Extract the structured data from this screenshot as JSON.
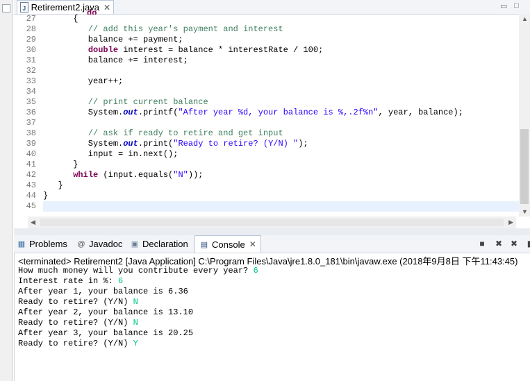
{
  "editor": {
    "tab_label": "Retirement2.java",
    "partial_line_text": "do",
    "lines": [
      {
        "n": "27",
        "tokens": [
          {
            "t": "      {",
            "c": ""
          }
        ]
      },
      {
        "n": "28",
        "tokens": [
          {
            "t": "         // add this year's payment and interest",
            "c": "cm"
          }
        ]
      },
      {
        "n": "29",
        "tokens": [
          {
            "t": "         balance += payment;",
            "c": ""
          }
        ]
      },
      {
        "n": "30",
        "tokens": [
          {
            "t": "         ",
            "c": ""
          },
          {
            "t": "double",
            "c": "kw"
          },
          {
            "t": " interest = balance * interestRate / 100;",
            "c": ""
          }
        ]
      },
      {
        "n": "31",
        "tokens": [
          {
            "t": "         balance += interest;",
            "c": ""
          }
        ]
      },
      {
        "n": "32",
        "tokens": []
      },
      {
        "n": "33",
        "tokens": [
          {
            "t": "         year++;",
            "c": ""
          }
        ]
      },
      {
        "n": "34",
        "tokens": []
      },
      {
        "n": "35",
        "tokens": [
          {
            "t": "         // print current balance",
            "c": "cm"
          }
        ]
      },
      {
        "n": "36",
        "tokens": [
          {
            "t": "         System.",
            "c": ""
          },
          {
            "t": "out",
            "c": "fi"
          },
          {
            "t": ".printf(",
            "c": ""
          },
          {
            "t": "\"After year %d, your balance is %,.2f%n\"",
            "c": "st"
          },
          {
            "t": ", year, balance);",
            "c": ""
          }
        ]
      },
      {
        "n": "37",
        "tokens": []
      },
      {
        "n": "38",
        "tokens": [
          {
            "t": "         // ask if ready to retire and get input",
            "c": "cm"
          }
        ]
      },
      {
        "n": "39",
        "tokens": [
          {
            "t": "         System.",
            "c": ""
          },
          {
            "t": "out",
            "c": "fi"
          },
          {
            "t": ".print(",
            "c": ""
          },
          {
            "t": "\"Ready to retire? (Y/N) \"",
            "c": "st"
          },
          {
            "t": ");",
            "c": ""
          }
        ]
      },
      {
        "n": "40",
        "tokens": [
          {
            "t": "         input = in.next();",
            "c": ""
          }
        ]
      },
      {
        "n": "41",
        "tokens": [
          {
            "t": "      }",
            "c": ""
          }
        ]
      },
      {
        "n": "42",
        "tokens": [
          {
            "t": "      ",
            "c": ""
          },
          {
            "t": "while",
            "c": "kw"
          },
          {
            "t": " (input.equals(",
            "c": ""
          },
          {
            "t": "\"N\"",
            "c": "st"
          },
          {
            "t": "));",
            "c": ""
          }
        ]
      },
      {
        "n": "43",
        "tokens": [
          {
            "t": "   }",
            "c": ""
          }
        ]
      },
      {
        "n": "44",
        "tokens": [
          {
            "t": "}",
            "c": ""
          }
        ]
      },
      {
        "n": "45",
        "tokens": [],
        "highlight": true
      }
    ]
  },
  "panel": {
    "tabs": {
      "problems": "Problems",
      "javadoc": "Javadoc",
      "declaration": "Declaration",
      "console": "Console"
    },
    "icons": {
      "problems": "problems-icon",
      "javadoc": "at-sign-icon",
      "declaration": "declaration-icon",
      "console": "console-icon"
    }
  },
  "console": {
    "description": "<terminated> Retirement2 [Java Application] C:\\Program Files\\Java\\jre1.8.0_181\\bin\\javaw.exe (2018年9月8日 下午11:43:45)",
    "output": [
      {
        "text": "How much money will you contribute every year? ",
        "input": "6"
      },
      {
        "text": "Interest rate in %: ",
        "input": "6"
      },
      {
        "text": "After year 1, your balance is 6.36",
        "input": ""
      },
      {
        "text": "Ready to retire? (Y/N) ",
        "input": "N"
      },
      {
        "text": "After year 2, your balance is 13.10",
        "input": ""
      },
      {
        "text": "Ready to retire? (Y/N) ",
        "input": "N"
      },
      {
        "text": "After year 3, your balance is 20.25",
        "input": ""
      },
      {
        "text": "Ready to retire? (Y/N) ",
        "input": "Y"
      }
    ]
  },
  "colors": {
    "comment": "#3f7f5f",
    "keyword": "#7f0055",
    "string": "#2a00ff",
    "field": "#0000c0",
    "console_input": "#00c87d",
    "current_line": "#e8f2fe"
  }
}
